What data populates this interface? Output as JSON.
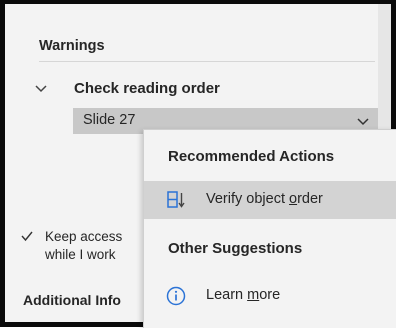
{
  "panel": {
    "section_title": "Warnings",
    "issue_title": "Check reading order",
    "slide_label": "Slide 27",
    "keep_line1": "Keep access",
    "keep_line2": "while I work",
    "additional_label": "Additional Info",
    "keep_checked": true
  },
  "menu": {
    "recommended_header": "Recommended Actions",
    "verify_pre": "Verify object ",
    "verify_accel": "o",
    "verify_post": "rder",
    "other_header": "Other Suggestions",
    "learn_pre": "Learn ",
    "learn_accel": "m",
    "learn_post": "ore"
  },
  "colors": {
    "accent": "#2b73d6",
    "highlight": "#d3d3d3"
  },
  "icons": {
    "expand": "chevron-down-icon",
    "dropdown": "chevron-down-icon",
    "verify": "reading-order-icon",
    "learn": "info-icon",
    "checkbox": "checkmark-icon"
  }
}
